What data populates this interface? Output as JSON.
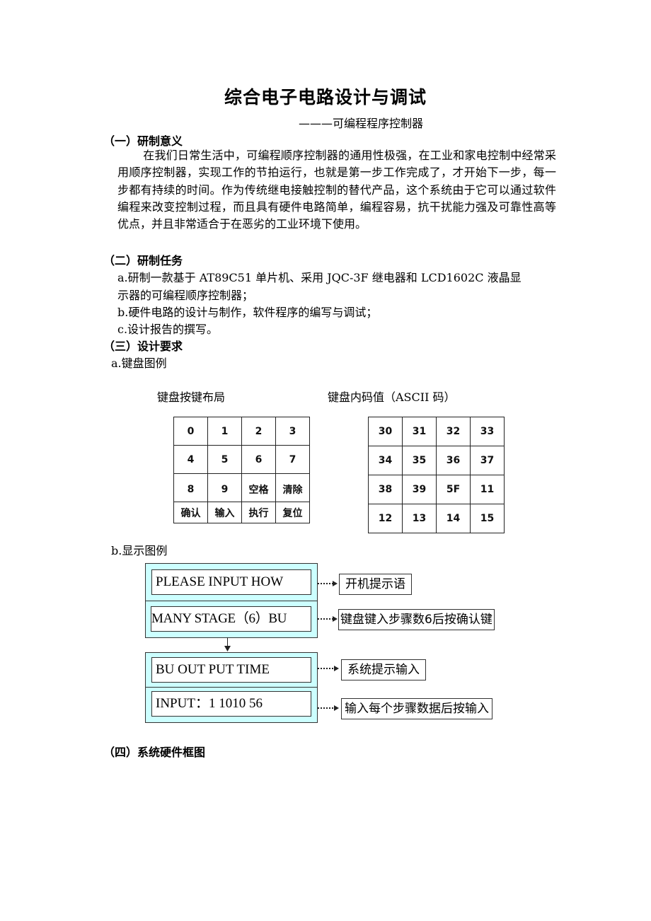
{
  "document": {
    "title": "综合电子电路设计与调试",
    "subtitle": "———可编程程序控制器"
  },
  "sections": {
    "s1": {
      "heading": "（一）研制意义",
      "paragraph": "在我们日常生活中，可编程顺序控制器的通用性极强，在工业和家电控制中经常采用顺序控制器，实现工作的节拍运行，也就是第一步工作完成了，才开始下一步，每一步都有持续的时间。作为传统继电接触控制的替代产品，这个系统由于它可以通过软件编程来改变控制过程，而且具有硬件电路简单，编程容易，抗干扰能力强及可靠性高等优点，并且非常适合于在恶劣的工业环境下使用。"
    },
    "s2": {
      "heading": "（二）研制任务",
      "items": [
        "a.研制一款基于 AT89C51 单片机、采用 JQC-3F 继电器和 LCD1602C 液晶显",
        "示器的可编程顺序控制器；",
        "b.硬件电路的设计与制作，软件程序的编写与调试；",
        "c.设计报告的撰写。"
      ]
    },
    "s3": {
      "heading": "（三）设计要求",
      "keyboard_label": "a.键盘图例",
      "keypad_caption": "键盘按键布局",
      "ascii_caption": "键盘内码值（ASCII 码）",
      "keypad": [
        [
          "0",
          "1",
          "2",
          "3"
        ],
        [
          "4",
          "5",
          "6",
          "7"
        ],
        [
          "8",
          "9",
          "空格",
          "清除"
        ],
        [
          "确认",
          "输入",
          "执行",
          "复位"
        ]
      ],
      "ascii_codes": [
        [
          "30",
          "31",
          "32",
          "33"
        ],
        [
          "34",
          "35",
          "36",
          "37"
        ],
        [
          "38",
          "39",
          "5F",
          "11"
        ],
        [
          "12",
          "13",
          "14",
          "15"
        ]
      ],
      "display_label": "b.显示图例",
      "display": {
        "screen1": {
          "line1": "PLEASE INPUT HOW",
          "line2": "MANY STAGE（6）BU",
          "note1": "开机提示语",
          "note2": "键盘键入步骤数6后按确认键"
        },
        "screen2": {
          "line1": "BU  OUT PUT  TIME",
          "line2": "INPUT：1  1010  56",
          "note1": "系统提示输入",
          "note2": "输入每个步骤数据后按输入"
        },
        "colors": {
          "lcd_background": "#ccffff"
        }
      }
    },
    "s4": {
      "heading": "（四）系统硬件框图"
    }
  }
}
